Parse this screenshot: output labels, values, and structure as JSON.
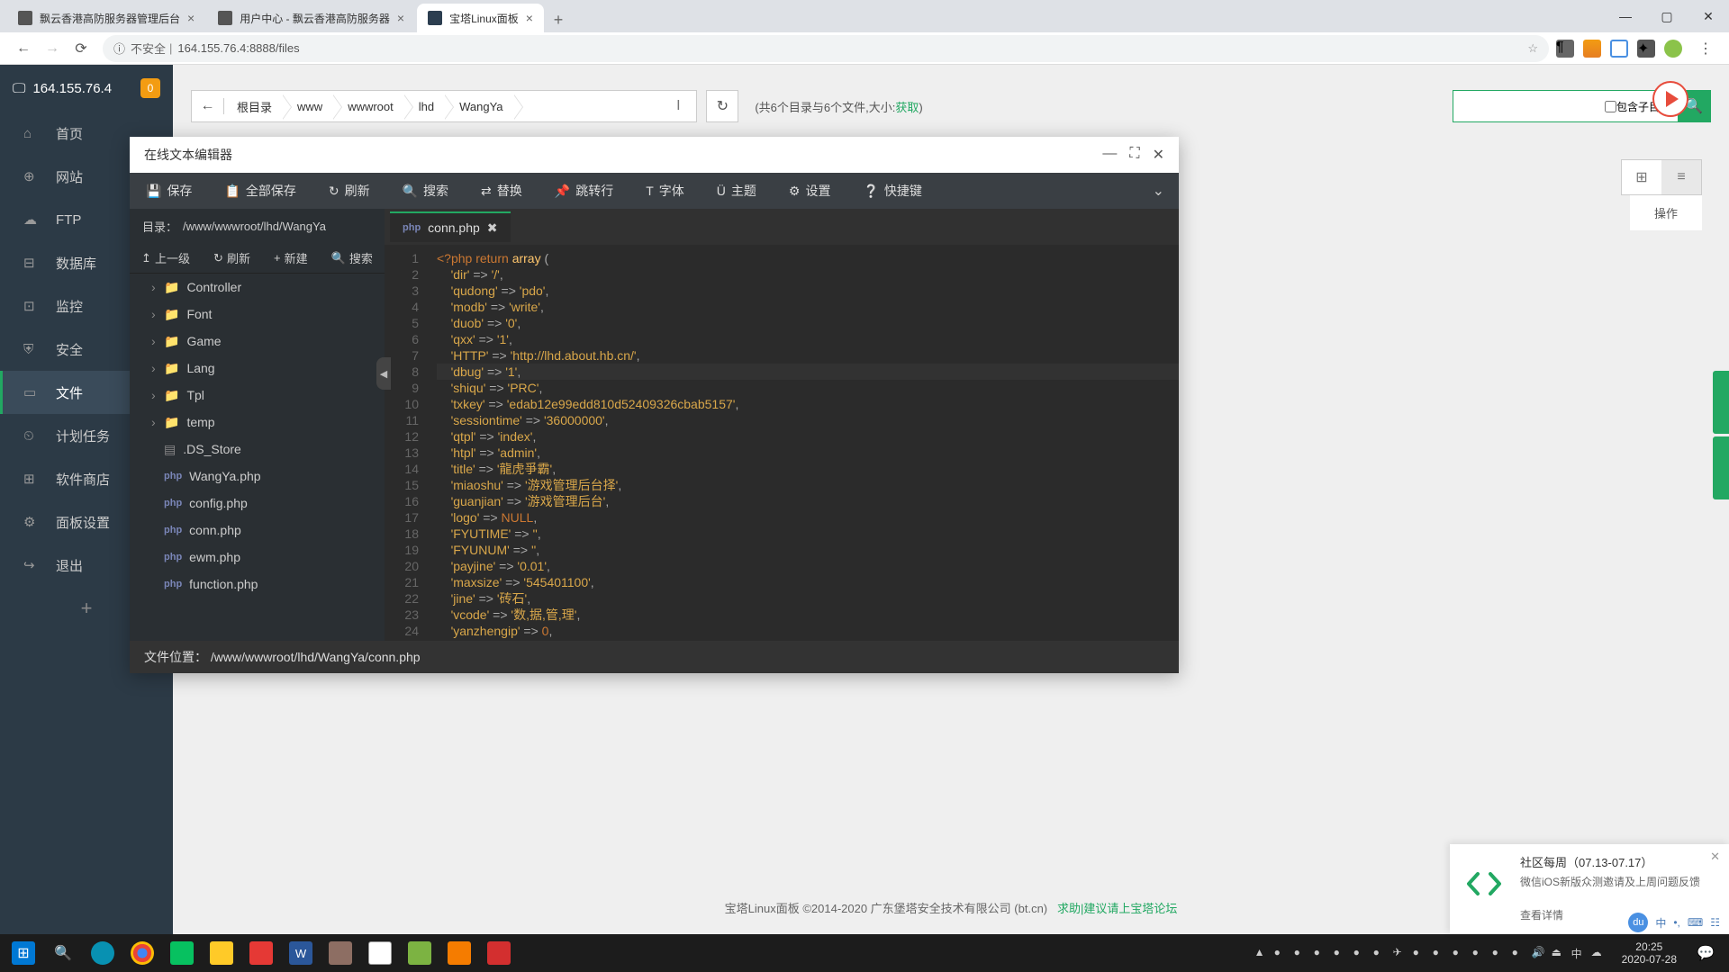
{
  "browser": {
    "tabs": [
      {
        "title": "飘云香港高防服务器管理后台",
        "active": false
      },
      {
        "title": "用户中心 - 飘云香港高防服务器",
        "active": false
      },
      {
        "title": "宝塔Linux面板",
        "active": true
      }
    ],
    "url_insecure": "不安全",
    "url": "164.155.76.4:8888/files"
  },
  "sidebar": {
    "server_ip": "164.155.76.4",
    "badge": "0",
    "items": [
      {
        "icon": "⌂",
        "label": "首页"
      },
      {
        "icon": "⊕",
        "label": "网站"
      },
      {
        "icon": "☁",
        "label": "FTP"
      },
      {
        "icon": "⊟",
        "label": "数据库"
      },
      {
        "icon": "⊡",
        "label": "监控"
      },
      {
        "icon": "⛨",
        "label": "安全"
      },
      {
        "icon": "▭",
        "label": "文件",
        "active": true
      },
      {
        "icon": "⏲",
        "label": "计划任务"
      },
      {
        "icon": "⊞",
        "label": "软件商店"
      },
      {
        "icon": "⚙",
        "label": "面板设置"
      },
      {
        "icon": "↪",
        "label": "退出"
      }
    ]
  },
  "filemanager": {
    "breadcrumbs": [
      "根目录",
      "www",
      "wwwroot",
      "lhd",
      "WangYa"
    ],
    "dir_info_prefix": "(共6个目录与6个文件,大小:",
    "dir_info_link": "获取",
    "dir_info_suffix": ")",
    "search_sub": "包含子目录",
    "col_ops": "操作"
  },
  "editor": {
    "title": "在线文本编辑器",
    "toolbar": [
      {
        "icon": "💾",
        "label": "保存"
      },
      {
        "icon": "📋",
        "label": "全部保存"
      },
      {
        "icon": "↻",
        "label": "刷新"
      },
      {
        "icon": "🔍",
        "label": "搜索"
      },
      {
        "icon": "⇄",
        "label": "替换"
      },
      {
        "icon": "📌",
        "label": "跳转行"
      },
      {
        "icon": "T",
        "label": "字体"
      },
      {
        "icon": "Ü",
        "label": "主题"
      },
      {
        "icon": "⚙",
        "label": "设置"
      },
      {
        "icon": "❔",
        "label": "快捷键"
      }
    ],
    "tree_label": "目录：",
    "tree_path": "/www/wwwroot/lhd/WangYa",
    "tree_tools": [
      {
        "icon": "↥",
        "label": "上一级"
      },
      {
        "icon": "↻",
        "label": "刷新"
      },
      {
        "icon": "+",
        "label": "新建"
      },
      {
        "icon": "🔍",
        "label": "搜索"
      }
    ],
    "tree_items": [
      {
        "type": "folder",
        "name": "Controller"
      },
      {
        "type": "folder",
        "name": "Font"
      },
      {
        "type": "folder",
        "name": "Game"
      },
      {
        "type": "folder",
        "name": "Lang"
      },
      {
        "type": "folder",
        "name": "Tpl"
      },
      {
        "type": "folder",
        "name": "temp"
      },
      {
        "type": "file",
        "name": ".DS_Store"
      },
      {
        "type": "php",
        "name": "WangYa.php"
      },
      {
        "type": "php",
        "name": "config.php"
      },
      {
        "type": "php",
        "name": "conn.php"
      },
      {
        "type": "php",
        "name": "ewm.php"
      },
      {
        "type": "php",
        "name": "function.php"
      }
    ],
    "active_tab": "conn.php",
    "file_location_label": "文件位置：",
    "file_location": "/www/wwwroot/lhd/WangYa/conn.php",
    "code": [
      {
        "n": 1,
        "html": "<span class='kw'>&lt;?php</span> <span class='kw'>return</span> <span class='func'>array</span> <span class='punc'>(</span>"
      },
      {
        "n": 2,
        "html": "    <span class='key'>'dir'</span> <span class='arrow'>=&gt;</span> <span class='str'>'/'</span><span class='punc'>,</span>"
      },
      {
        "n": 3,
        "html": "    <span class='key'>'qudong'</span> <span class='arrow'>=&gt;</span> <span class='str'>'pdo'</span><span class='punc'>,</span>"
      },
      {
        "n": 4,
        "html": "    <span class='key'>'modb'</span> <span class='arrow'>=&gt;</span> <span class='str'>'write'</span><span class='punc'>,</span>"
      },
      {
        "n": 5,
        "html": "    <span class='key'>'duob'</span> <span class='arrow'>=&gt;</span> <span class='str'>'0'</span><span class='punc'>,</span>"
      },
      {
        "n": 6,
        "html": "    <span class='key'>'qxx'</span> <span class='arrow'>=&gt;</span> <span class='str'>'1'</span><span class='punc'>,</span>"
      },
      {
        "n": 7,
        "html": "    <span class='key'>'HTTP'</span> <span class='arrow'>=&gt;</span> <span class='str'>'http://lhd.about.hb.cn/'</span><span class='punc'>,</span>"
      },
      {
        "n": 8,
        "hl": true,
        "html": "    <span class='key'>'dbug'</span> <span class='arrow'>=&gt;</span> <span class='str'>'1'</span><span class='punc'>,</span>"
      },
      {
        "n": 9,
        "html": "    <span class='key'>'shiqu'</span> <span class='arrow'>=&gt;</span> <span class='str'>'PRC'</span><span class='punc'>,</span>"
      },
      {
        "n": 10,
        "html": "    <span class='key'>'txkey'</span> <span class='arrow'>=&gt;</span> <span class='str'>'edab12e99edd810d52409326cbab5157'</span><span class='punc'>,</span>"
      },
      {
        "n": 11,
        "html": "    <span class='key'>'sessiontime'</span> <span class='arrow'>=&gt;</span> <span class='str'>'36000000'</span><span class='punc'>,</span>"
      },
      {
        "n": 12,
        "html": "    <span class='key'>'qtpl'</span> <span class='arrow'>=&gt;</span> <span class='str'>'index'</span><span class='punc'>,</span>"
      },
      {
        "n": 13,
        "html": "    <span class='key'>'htpl'</span> <span class='arrow'>=&gt;</span> <span class='str'>'admin'</span><span class='punc'>,</span>"
      },
      {
        "n": 14,
        "html": "    <span class='key'>'title'</span> <span class='arrow'>=&gt;</span> <span class='str'>'龍虎爭霸'</span><span class='punc'>,</span>"
      },
      {
        "n": 15,
        "html": "    <span class='key'>'miaoshu'</span> <span class='arrow'>=&gt;</span> <span class='str'>'游戏管理后台择'</span><span class='punc'>,</span>"
      },
      {
        "n": 16,
        "html": "    <span class='key'>'guanjian'</span> <span class='arrow'>=&gt;</span> <span class='str'>'游戏管理后台'</span><span class='punc'>,</span>"
      },
      {
        "n": 17,
        "html": "    <span class='key'>'logo'</span> <span class='arrow'>=&gt;</span> <span class='num'>NULL</span><span class='punc'>,</span>"
      },
      {
        "n": 18,
        "html": "    <span class='key'>'FYUTIME'</span> <span class='arrow'>=&gt;</span> <span class='str'>''</span><span class='punc'>,</span>"
      },
      {
        "n": 19,
        "html": "    <span class='key'>'FYUNUM'</span> <span class='arrow'>=&gt;</span> <span class='str'>''</span><span class='punc'>,</span>"
      },
      {
        "n": 20,
        "html": "    <span class='key'>'payjine'</span> <span class='arrow'>=&gt;</span> <span class='str'>'0.01'</span><span class='punc'>,</span>"
      },
      {
        "n": 21,
        "html": "    <span class='key'>'maxsize'</span> <span class='arrow'>=&gt;</span> <span class='str'>'545401100'</span><span class='punc'>,</span>"
      },
      {
        "n": 22,
        "html": "    <span class='key'>'jine'</span> <span class='arrow'>=&gt;</span> <span class='str'>'砖石'</span><span class='punc'>,</span>"
      },
      {
        "n": 23,
        "html": "    <span class='key'>'vcode'</span> <span class='arrow'>=&gt;</span> <span class='str'>'数,据,管,理'</span><span class='punc'>,</span>"
      },
      {
        "n": 24,
        "html": "    <span class='key'>'yanzhengip'</span> <span class='arrow'>=&gt;</span> <span class='num'>0</span><span class='punc'>,</span>"
      }
    ]
  },
  "footer": {
    "copy": "宝塔Linux面板 ©2014-2020 广东堡塔安全技术有限公司 (bt.cn)",
    "help": "求助|建议请上宝塔论坛"
  },
  "notif": {
    "title": "社区每周（07.13-07.17）",
    "desc": "微信iOS新版众测邀请及上周问题反馈",
    "link": "查看详情"
  },
  "taskbar": {
    "time": "20:25",
    "date": "2020-07-28"
  },
  "ime": {
    "items": [
      "中",
      "•,",
      "❏",
      "☷"
    ]
  }
}
